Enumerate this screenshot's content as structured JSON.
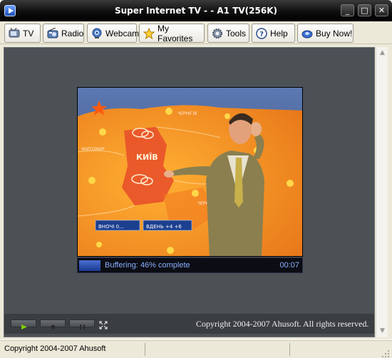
{
  "window": {
    "title": "Super Internet TV -           - A1 TV(256K)",
    "buttons": {
      "minimize": "_",
      "maximize": "□",
      "close": "✕"
    }
  },
  "toolbar": {
    "tv": "TV",
    "radio": "Radio",
    "webcam": "Webcam",
    "favorites": "My Favorites",
    "tools": "Tools",
    "help": "Help",
    "buy": "Buy Now!"
  },
  "player": {
    "status": "Buffering: 46% complete",
    "time": "00:07",
    "buffer_progress": 0.46,
    "copyright": "Copyright 2004-2007 Ahusoft. All rights reserved."
  },
  "video_overlay": {
    "city": "КИЇВ",
    "region1": "ЧЕРНІГІВ",
    "region2": "ЖИТОМИР",
    "region3": "ЧЕРКАСИ",
    "ticker_left": "ВНОЧІ   0...",
    "ticker_right": "ВДЕНЬ +4 +6"
  },
  "statusbar": {
    "text": "Copyright 2004-2007 Ahusoft"
  },
  "colors": {
    "viewport": "#4c5156",
    "status_text": "#8ab0ff",
    "map_orange": "#f39a2a"
  }
}
